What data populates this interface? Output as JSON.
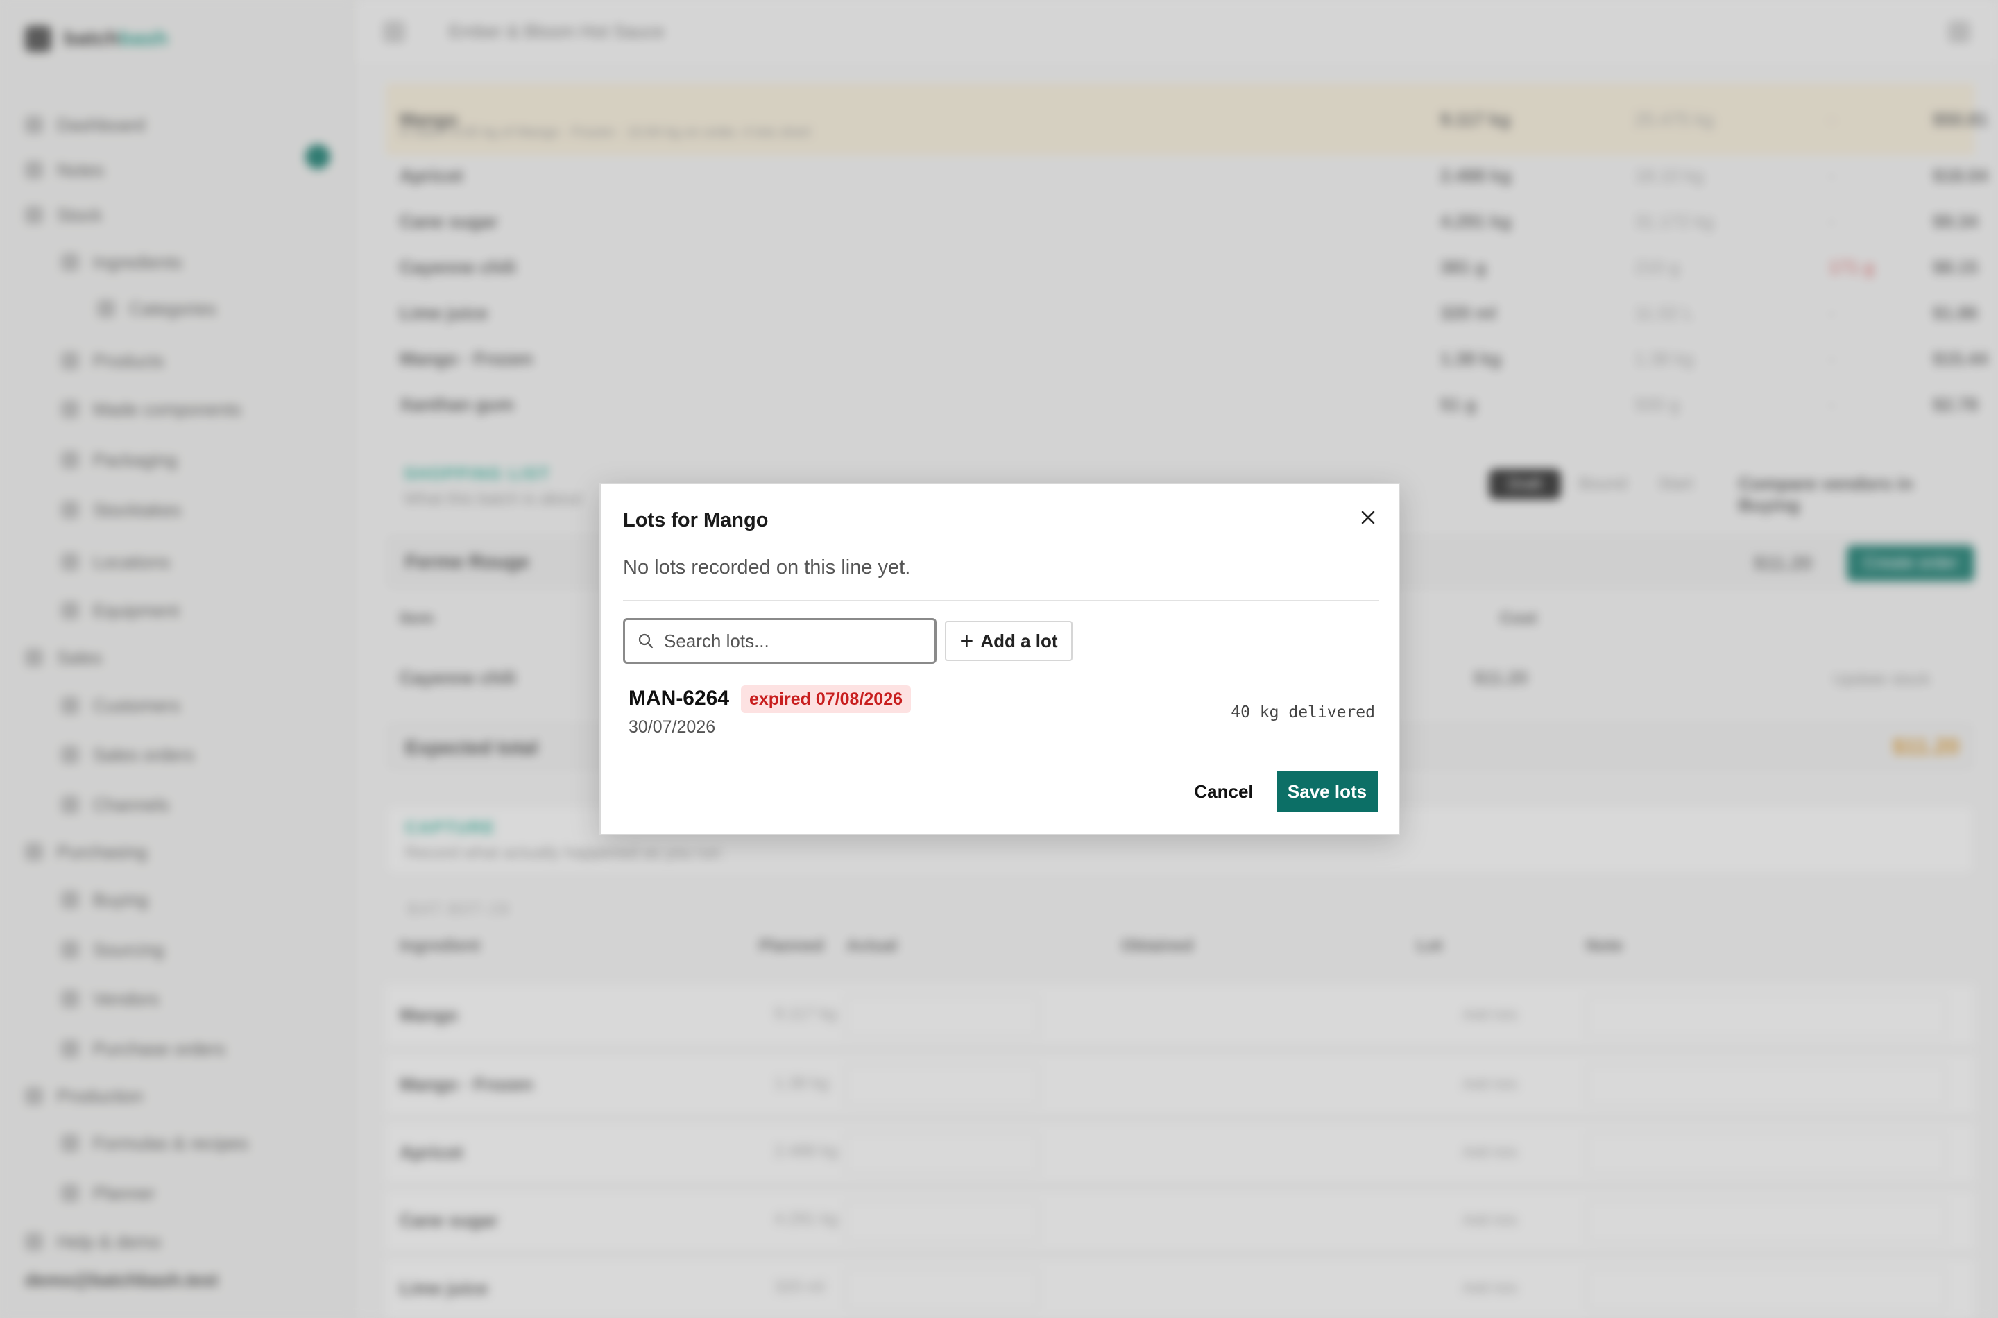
{
  "background": {
    "brand": {
      "name_a": "batch",
      "name_b": "bash"
    },
    "breadcrumb": "Ember & Bloom Hot Sauce",
    "nav": [
      "Dashboard",
      "Notes",
      "Stock",
      "Ingredients",
      "Categories",
      "Products",
      "Made components",
      "Packaging",
      "Stocktakes",
      "Locations",
      "Equipment",
      "Sales",
      "Customers",
      "Sales orders",
      "Channels",
      "Purchasing",
      "Buying",
      "Sourcing",
      "Vendors",
      "Purchase orders",
      "Production",
      "Formulas & recipes",
      "Planner",
      "Help & demo"
    ],
    "user": "demo@batchbash.test",
    "ingredient_rows": [
      {
        "name": "Mango",
        "sub": "in batch 8.65 kg of Mango · Frozen · 10.84 kg on order, 4 lots short",
        "a": "9.117 kg",
        "b": "25.475 kg",
        "c": "-",
        "d": "$50.81"
      },
      {
        "name": "Apricot",
        "a": "2.488 kg",
        "b": "18.10 kg",
        "c": "-",
        "d": "$18.04"
      },
      {
        "name": "Cane sugar",
        "a": "4.291 kg",
        "b": "31.172 kg",
        "c": "-",
        "d": "$9.34"
      },
      {
        "name": "Cayenne chili",
        "a": "381 g",
        "b": "210 g",
        "c": "171 g",
        "d": "$8.15"
      },
      {
        "name": "Lime juice",
        "a": "320 ml",
        "b": "11.02 L",
        "c": "-",
        "d": "$1.86"
      },
      {
        "name": "Mango · Frozen",
        "a": "1.38 kg",
        "b": "1.38 kg",
        "c": "-",
        "d": "$15.44"
      },
      {
        "name": "Xanthan gum",
        "a": "51 g",
        "b": "500 g",
        "c": "-",
        "d": "$2.78"
      }
    ],
    "shopping": {
      "label": "SHOPPING LIST",
      "desc": "What this batch is about",
      "pill": "Draft",
      "tabs": [
        "Bound",
        "Start"
      ],
      "compare": "Compare vendors in Buying",
      "vendor": "Ferme Rouge",
      "vendor_total": "$11.20",
      "create_btn": "Create order",
      "col_item": "Item",
      "col_cost": "Cost",
      "item": "Cayenne chili",
      "item_cost": "$11.20",
      "item_action": "Update stock",
      "expected_label": "Expected total",
      "expected_value": "$11.20"
    },
    "capture": {
      "label": "CAPTURE",
      "desc": "Record what actually happened as you run",
      "batch": "BAT-B0T-28",
      "cols": [
        "Ingredient",
        "Planned",
        "Actual",
        "Obtained",
        "Lot",
        "Note"
      ],
      "rows": [
        {
          "name": "Mango",
          "planned": "9.117 kg",
          "lot": "Add lots"
        },
        {
          "name": "Mango · Frozen",
          "planned": "1.38 kg",
          "lot": "Add lots"
        },
        {
          "name": "Apricot",
          "planned": "2.488 kg",
          "lot": "Add lots"
        },
        {
          "name": "Cane sugar",
          "planned": "4.291 kg",
          "lot": "Add lots"
        },
        {
          "name": "Lime juice",
          "planned": "320 ml",
          "lot": "Add lots"
        }
      ]
    }
  },
  "modal": {
    "title": "Lots for Mango",
    "description": "No lots recorded on this line yet.",
    "search_placeholder": "Search lots...",
    "add_label": "Add a lot",
    "lots": [
      {
        "code": "MAN-6264",
        "badge": "expired 07/08/2026",
        "date": "30/07/2026",
        "qty": "40 kg delivered"
      }
    ],
    "cancel_label": "Cancel",
    "save_label": "Save lots"
  },
  "colors": {
    "accent": "#0c6f66",
    "expired_bg": "#fde2e2",
    "expired_text": "#c81e1e"
  }
}
